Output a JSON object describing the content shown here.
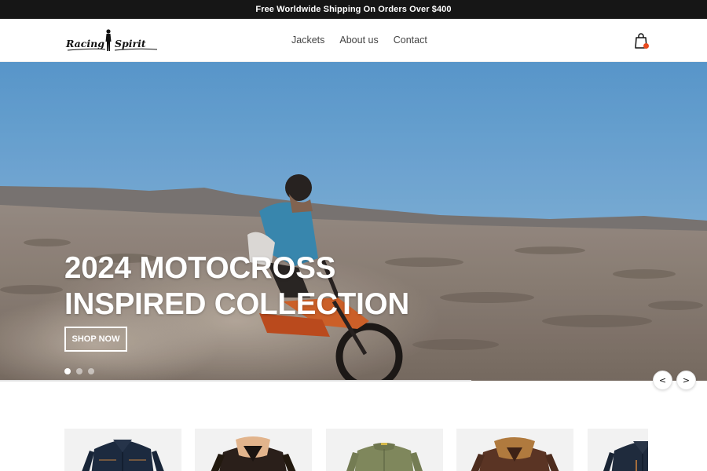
{
  "announcement": {
    "text": "Free Worldwide Shipping On Orders Over $400"
  },
  "header": {
    "logo_text": {
      "left": "Racing",
      "right": "Spirit"
    },
    "nav": [
      {
        "label": "Jackets"
      },
      {
        "label": "About us"
      },
      {
        "label": "Contact"
      }
    ],
    "cart_icon": "shopping-bag-icon",
    "cart_badge_color": "#e8491d"
  },
  "hero": {
    "title_line1": "2024 MOTOCROSS",
    "title_line2": "INSPIRED COLLECTION",
    "cta": "SHOP NOW",
    "slides_total": 3,
    "active_slide": 1
  },
  "carousel": {
    "prev_label": "<",
    "next_label": ">"
  },
  "products": [
    {
      "name": "denim-jacket"
    },
    {
      "name": "shearling-collar-jacket"
    },
    {
      "name": "olive-bomber-jacket"
    },
    {
      "name": "brown-shearling-jacket"
    },
    {
      "name": "denim-jacket"
    }
  ]
}
